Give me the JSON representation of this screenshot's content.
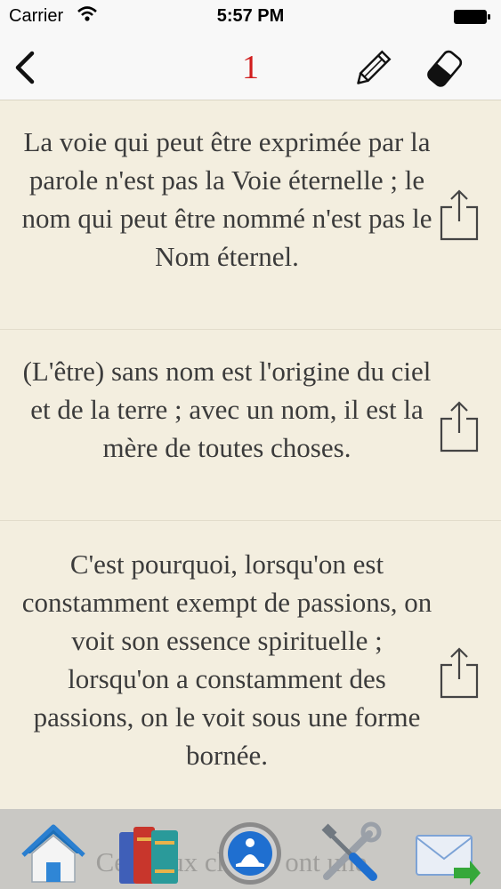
{
  "status": {
    "carrier": "Carrier",
    "time": "5:57 PM"
  },
  "nav": {
    "title": "1"
  },
  "paragraphs": [
    {
      "text": "La voie qui peut être exprimée par la parole n'est pas la Voie éternelle ; le nom qui peut être nommé n'est pas le Nom éternel."
    },
    {
      "text": "(L'être) sans nom est l'origine du ciel et de la terre ; avec un nom, il est la mère de toutes choses."
    },
    {
      "text": "C'est pourquoi, lorsqu'on est constamment exempt de passions, on voit son essence spirituelle ; lorsqu'on a constamment des passions, on le voit sous une forme bornée."
    }
  ],
  "partial_text": "Ces deux choses ont une",
  "tabs": [
    {
      "icon": "home-icon"
    },
    {
      "icon": "books-icon"
    },
    {
      "icon": "meditation-icon"
    },
    {
      "icon": "tools-icon"
    },
    {
      "icon": "mail-icon"
    }
  ],
  "colors": {
    "title": "#d11d1d",
    "text": "#3b3b3b",
    "paper": "#f3eedf",
    "tabbar": "#c9c8c4"
  }
}
